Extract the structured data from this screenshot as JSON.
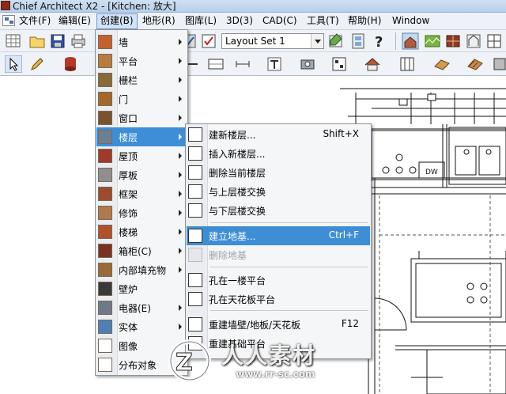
{
  "window": {
    "title": "Chief Architect X2 - [Kitchen: 放大]"
  },
  "menubar": {
    "items": [
      {
        "label": "文件(F)"
      },
      {
        "label": "编辑(E)"
      },
      {
        "label": "创建(B)",
        "active": true
      },
      {
        "label": "地形(R)"
      },
      {
        "label": "图库(L)"
      },
      {
        "label": "3D(3)"
      },
      {
        "label": "CAD(C)"
      },
      {
        "label": "工具(T)"
      },
      {
        "label": "帮助(H)"
      },
      {
        "label": "Window"
      }
    ]
  },
  "toolbar": {
    "layout_set": "Layout Set 1"
  },
  "create_menu": {
    "items": [
      {
        "label": "墙",
        "icon": "wall-icon",
        "submenu": true
      },
      {
        "label": "平台",
        "icon": "deck-icon",
        "submenu": true
      },
      {
        "label": "栅栏",
        "icon": "fence-icon",
        "submenu": true
      },
      {
        "label": "门",
        "icon": "door-icon",
        "submenu": true
      },
      {
        "label": "窗口",
        "icon": "window-icon",
        "submenu": true
      },
      {
        "label": "楼层",
        "icon": "floor-icon",
        "submenu": true,
        "highlighted": true
      },
      {
        "label": "屋顶",
        "icon": "roof-icon",
        "submenu": true
      },
      {
        "label": "厚板",
        "icon": "slab-icon",
        "submenu": true
      },
      {
        "label": "框架",
        "icon": "framing-icon",
        "submenu": true
      },
      {
        "label": "修饰",
        "icon": "trim-icon",
        "submenu": true
      },
      {
        "label": "楼梯",
        "icon": "stairs-icon",
        "submenu": true
      },
      {
        "label": "箱柜(C)",
        "icon": "cabinet-icon",
        "submenu": true
      },
      {
        "label": "内部填充物",
        "icon": "interior-fill-icon",
        "submenu": true
      },
      {
        "label": "壁炉",
        "icon": "fireplace-icon",
        "submenu": false
      },
      {
        "label": "电器(E)",
        "icon": "electrical-icon",
        "submenu": true
      },
      {
        "label": "实体",
        "icon": "solid-icon",
        "submenu": true
      },
      {
        "label": "图像",
        "icon": "image-icon",
        "submenu": false
      },
      {
        "label": "分布对象",
        "icon": "distribute-icon",
        "submenu": false
      }
    ]
  },
  "floor_submenu": {
    "items": [
      {
        "label": "建新楼层...",
        "shortcut": "Shift+X",
        "icon": "new-floor-icon"
      },
      {
        "label": "插入新楼层...",
        "shortcut": "",
        "icon": "insert-floor-icon"
      },
      {
        "label": "删除当前楼层",
        "shortcut": "",
        "icon": "delete-floor-icon"
      },
      {
        "label": "与上层楼交换",
        "shortcut": "",
        "icon": "swap-up-icon"
      },
      {
        "label": "与下层楼交换",
        "shortcut": "",
        "icon": "swap-down-icon"
      },
      {
        "label": "建立地基...",
        "shortcut": "Ctrl+F",
        "icon": "build-foundation-icon",
        "highlighted": true
      },
      {
        "label": "删除地基",
        "shortcut": "",
        "icon": "delete-foundation-icon",
        "disabled": true
      },
      {
        "label": "孔在一楼平台",
        "shortcut": "",
        "icon": "hole-first-floor-icon"
      },
      {
        "label": "孔在天花板平台",
        "shortcut": "",
        "icon": "hole-ceiling-icon"
      },
      {
        "label": "重建墙壁/地板/天花板",
        "shortcut": "F12",
        "icon": "rebuild-icon"
      },
      {
        "label": "重建基础平台",
        "shortcut": "",
        "icon": "rebuild-platform-icon"
      }
    ]
  },
  "drawing": {
    "label_dw": "DW"
  },
  "watermark": {
    "text": "人人素材",
    "url": "www.rr-sc.com"
  },
  "colors": {
    "highlight": "#3e8ed6",
    "menu_bg": "#f5f6f7",
    "titlebar": "#b7cfe9"
  }
}
